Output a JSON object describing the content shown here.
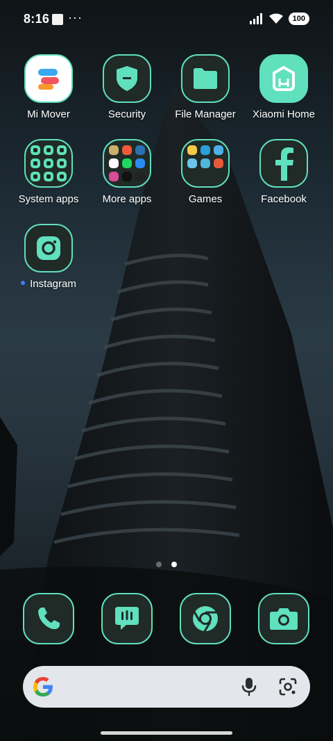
{
  "status_bar": {
    "time": "8:16",
    "notif_more": "···",
    "battery": "100"
  },
  "apps": [
    {
      "label": "Mi Mover",
      "icon": "mi-mover-icon"
    },
    {
      "label": "Security",
      "icon": "shield-icon"
    },
    {
      "label": "File Manager",
      "icon": "folder-icon"
    },
    {
      "label": "Xiaomi Home",
      "icon": "mi-home-icon"
    },
    {
      "label": "System apps",
      "icon": "folder-system-apps-icon"
    },
    {
      "label": "More apps",
      "icon": "folder-more-apps-icon"
    },
    {
      "label": "Games",
      "icon": "folder-games-icon"
    },
    {
      "label": "Facebook",
      "icon": "facebook-icon"
    },
    {
      "label": "Instagram",
      "icon": "instagram-icon",
      "new_dot": true
    }
  ],
  "pages": {
    "count": 2,
    "active": 2
  },
  "dock": [
    {
      "name": "phone",
      "icon": "phone-icon"
    },
    {
      "name": "messages",
      "icon": "message-icon"
    },
    {
      "name": "chrome",
      "icon": "chrome-icon"
    },
    {
      "name": "camera",
      "icon": "camera-icon"
    }
  ],
  "search": {
    "logo": "google-g-icon",
    "mic": "microphone-icon",
    "lens": "google-lens-icon"
  },
  "colors": {
    "accent": "#60e0bd",
    "icon_bg": "#202a27",
    "search_bg": "#e3e6ea"
  }
}
